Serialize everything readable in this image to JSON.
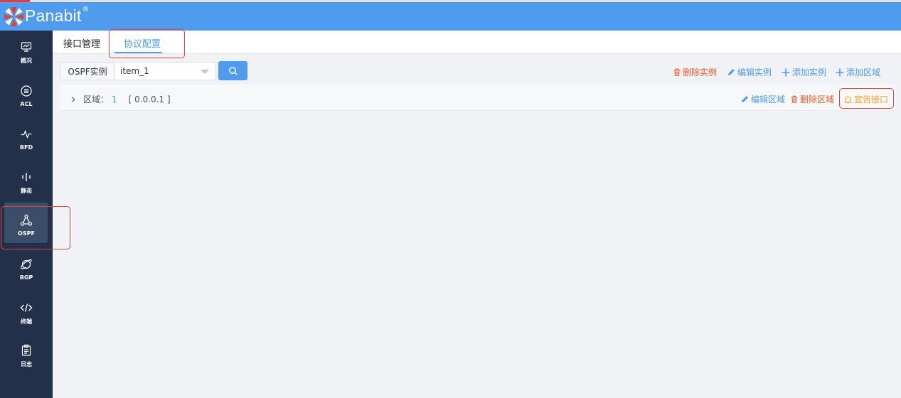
{
  "app": {
    "logo_text": "Panabit",
    "logo_reg": "®"
  },
  "sidebar": {
    "items": [
      {
        "label": "概况",
        "icon": "monitor-icon"
      },
      {
        "label": "ACL",
        "icon": "list-circle-icon"
      },
      {
        "label": "BFD",
        "icon": "pulse-icon"
      },
      {
        "label": "静态",
        "icon": "bars-icon"
      },
      {
        "label": "OSPF",
        "icon": "network-nodes-icon",
        "active": true
      },
      {
        "label": "BGP",
        "icon": "planet-icon"
      },
      {
        "label": "终端",
        "icon": "code-icon"
      },
      {
        "label": "日志",
        "icon": "clipboard-icon"
      }
    ]
  },
  "tabs": [
    {
      "label": "接口管理",
      "active": false
    },
    {
      "label": "协议配置",
      "active": true
    }
  ],
  "toolbar": {
    "instance_label": "OSPF实例",
    "instance_value": "item_1",
    "actions": [
      {
        "label": "删除实例",
        "color": "#f2572d"
      },
      {
        "label": "编辑实例",
        "color": "#4e9bf0"
      },
      {
        "label": "添加实例",
        "color": "#4e9bf0"
      },
      {
        "label": "添加区域",
        "color": "#4e9bf0"
      }
    ]
  },
  "area": {
    "prefix": "区域：",
    "id": "1",
    "addr": "[ 0.0.0.1 ]",
    "actions": [
      {
        "label": "编辑区域",
        "color": "#4e9bf0"
      },
      {
        "label": "删除区域",
        "color": "#f2572d"
      },
      {
        "label": "宣告接口",
        "color": "#f5a623"
      }
    ]
  },
  "colors": {
    "header": "#4e9bf0",
    "sidebar": "#223149",
    "accent": "#4e9bf0",
    "danger": "#f2572d",
    "warning": "#f5a623",
    "highlight": "#e0463b"
  }
}
